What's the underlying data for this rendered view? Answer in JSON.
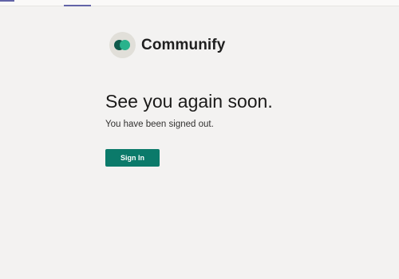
{
  "app": {
    "name": "Communify",
    "logo_icon": "communify-logo-icon",
    "colors": {
      "background": "#f3f2f1",
      "logo_dark": "#0f5a4b",
      "logo_light": "#2ab28c",
      "button": "#0b7a6a",
      "top_accent": "#6264a7"
    }
  },
  "main": {
    "headline": "See you again soon.",
    "message": "You have been signed out.",
    "signin_label": "Sign In"
  }
}
